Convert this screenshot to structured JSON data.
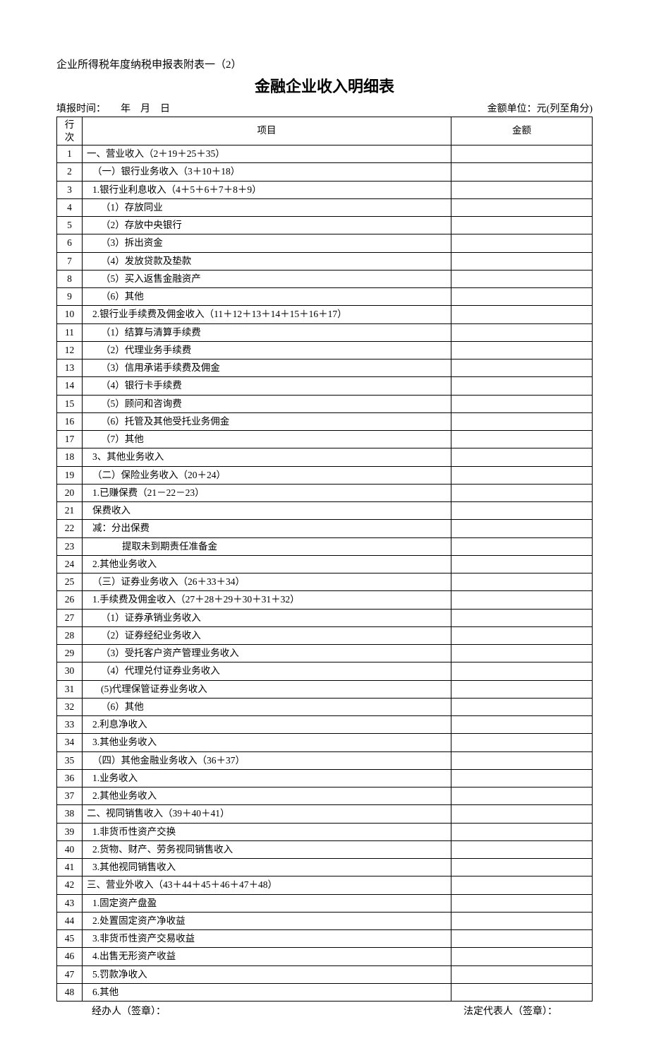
{
  "subtitle": "企业所得税年度纳税申报表附表一（2）",
  "main_title": "金融企业收入明细表",
  "header": {
    "left": "填报时间：　　年　月　日",
    "right": "金额单位：元(列至角分)"
  },
  "table": {
    "head_row": "行\n次",
    "head_item": "项目",
    "head_amount": "金额",
    "rows": [
      {
        "n": "1",
        "item": "一、营业收入（2＋19＋25＋35）",
        "amount": "",
        "cls": ""
      },
      {
        "n": "2",
        "item": "（一）银行业务收入（3＋10＋18）",
        "amount": "",
        "cls": "indent1"
      },
      {
        "n": "3",
        "item": "1.银行业利息收入（4＋5＋6＋7＋8＋9）",
        "amount": "",
        "cls": "indent1"
      },
      {
        "n": "4",
        "item": "（1）存放同业",
        "amount": "",
        "cls": "indent2"
      },
      {
        "n": "5",
        "item": "（2）存放中央银行",
        "amount": "",
        "cls": "indent2"
      },
      {
        "n": "6",
        "item": "（3）拆出资金",
        "amount": "",
        "cls": "indent2"
      },
      {
        "n": "7",
        "item": "（4）发放贷款及垫款",
        "amount": "",
        "cls": "indent2"
      },
      {
        "n": "8",
        "item": "（5）买入返售金融资产",
        "amount": "",
        "cls": "indent2"
      },
      {
        "n": "9",
        "item": "（6）其他",
        "amount": "",
        "cls": "indent2"
      },
      {
        "n": "10",
        "item": "2.银行业手续费及佣金收入（11＋12＋13＋14＋15＋16＋17）",
        "amount": "",
        "cls": "indent1"
      },
      {
        "n": "11",
        "item": "（1）结算与清算手续费",
        "amount": "",
        "cls": "indent2"
      },
      {
        "n": "12",
        "item": "（2）代理业务手续费",
        "amount": "",
        "cls": "indent2"
      },
      {
        "n": "13",
        "item": "（3）信用承诺手续费及佣金",
        "amount": "",
        "cls": "indent2"
      },
      {
        "n": "14",
        "item": "（4）银行卡手续费",
        "amount": "",
        "cls": "indent2"
      },
      {
        "n": "15",
        "item": "（5）顾问和咨询费",
        "amount": "",
        "cls": "indent2"
      },
      {
        "n": "16",
        "item": "（6）托管及其他受托业务佣金",
        "amount": "",
        "cls": "indent2"
      },
      {
        "n": "17",
        "item": "（7）其他",
        "amount": "",
        "cls": "indent2"
      },
      {
        "n": "18",
        "item": "3、其他业务收入",
        "amount": "",
        "cls": "indent1"
      },
      {
        "n": "19",
        "item": "（二）保险业务收入（20＋24）",
        "amount": "",
        "cls": "indent1"
      },
      {
        "n": "20",
        "item": "1.已赚保费（21－22－23）",
        "amount": "",
        "cls": "indent1"
      },
      {
        "n": "21",
        "item": "保费收入",
        "amount": "",
        "cls": "indent1"
      },
      {
        "n": "22",
        "item": "减：分出保费",
        "amount": "",
        "cls": "indent1"
      },
      {
        "n": "23",
        "item": "提取未到期责任准备金",
        "amount": "",
        "cls": "indent3"
      },
      {
        "n": "24",
        "item": "2.其他业务收入",
        "amount": "",
        "cls": "indent1"
      },
      {
        "n": "25",
        "item": "（三）证券业务收入（26＋33＋34）",
        "amount": "",
        "cls": "indent1"
      },
      {
        "n": "26",
        "item": "1.手续费及佣金收入（27＋28＋29＋30＋31＋32）",
        "amount": "",
        "cls": "indent1"
      },
      {
        "n": "27",
        "item": "（1）证券承销业务收入",
        "amount": "",
        "cls": "indent2"
      },
      {
        "n": "28",
        "item": "（2）证券经纪业务收入",
        "amount": "",
        "cls": "indent2"
      },
      {
        "n": "29",
        "item": "（3）受托客户资产管理业务收入",
        "amount": "",
        "cls": "indent2"
      },
      {
        "n": "30",
        "item": "（4）代理兑付证券业务收入",
        "amount": "",
        "cls": "indent2"
      },
      {
        "n": "31",
        "item": "(5)代理保管证券业务收入",
        "amount": "",
        "cls": "indent2"
      },
      {
        "n": "32",
        "item": "（6）其他",
        "amount": "",
        "cls": "indent2"
      },
      {
        "n": "33",
        "item": "2.利息净收入",
        "amount": "",
        "cls": "indent1"
      },
      {
        "n": "34",
        "item": "3.其他业务收入",
        "amount": "",
        "cls": "indent1"
      },
      {
        "n": "35",
        "item": "（四）其他金融业务收入（36＋37）",
        "amount": "",
        "cls": "indent1"
      },
      {
        "n": "36",
        "item": "1.业务收入",
        "amount": "",
        "cls": "indent1"
      },
      {
        "n": "37",
        "item": "2.其他业务收入",
        "amount": "",
        "cls": "indent1"
      },
      {
        "n": "38",
        "item": "二、视同销售收入（39＋40＋41）",
        "amount": "",
        "cls": ""
      },
      {
        "n": "39",
        "item": "1.非货币性资产交换",
        "amount": "",
        "cls": "indent1"
      },
      {
        "n": "40",
        "item": "2.货物、财产、劳务视同销售收入",
        "amount": "",
        "cls": "indent1"
      },
      {
        "n": "41",
        "item": "3.其他视同销售收入",
        "amount": "",
        "cls": "indent1"
      },
      {
        "n": "42",
        "item": "三、营业外收入（43＋44＋45＋46＋47＋48）",
        "amount": "",
        "cls": ""
      },
      {
        "n": "43",
        "item": "1.固定资产盘盈",
        "amount": "",
        "cls": "indent1"
      },
      {
        "n": "44",
        "item": "2.处置固定资产净收益",
        "amount": "",
        "cls": "indent1"
      },
      {
        "n": "45",
        "item": "3.非货币性资产交易收益",
        "amount": "",
        "cls": "indent1"
      },
      {
        "n": "46",
        "item": "4.出售无形资产收益",
        "amount": "",
        "cls": "indent1"
      },
      {
        "n": "47",
        "item": "5.罚款净收入",
        "amount": "",
        "cls": "indent1"
      },
      {
        "n": "48",
        "item": "6.其他",
        "amount": "",
        "cls": "indent1"
      }
    ]
  },
  "footer": {
    "left": "经办人（签章）：",
    "right": "法定代表人（签章）："
  }
}
